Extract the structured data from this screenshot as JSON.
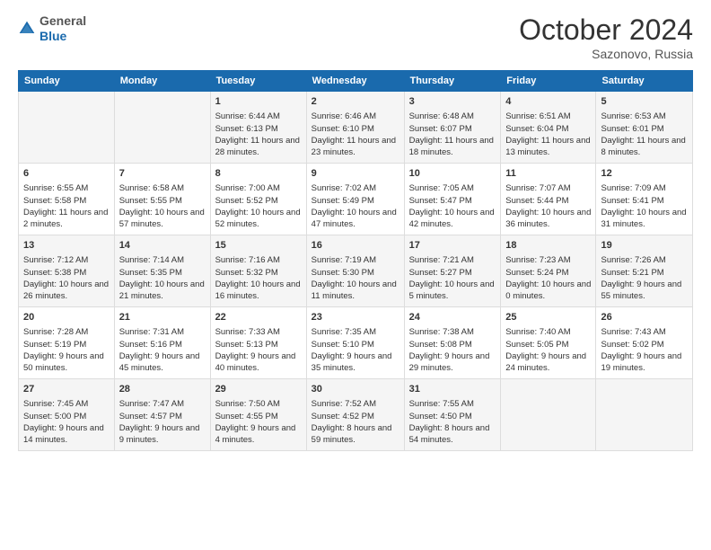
{
  "header": {
    "logo_general": "General",
    "logo_blue": "Blue",
    "month_title": "October 2024",
    "location": "Sazonovo, Russia"
  },
  "days_of_week": [
    "Sunday",
    "Monday",
    "Tuesday",
    "Wednesday",
    "Thursday",
    "Friday",
    "Saturday"
  ],
  "weeks": [
    [
      {
        "day": "",
        "content": ""
      },
      {
        "day": "",
        "content": ""
      },
      {
        "day": "1",
        "content": "Sunrise: 6:44 AM\nSunset: 6:13 PM\nDaylight: 11 hours and 28 minutes."
      },
      {
        "day": "2",
        "content": "Sunrise: 6:46 AM\nSunset: 6:10 PM\nDaylight: 11 hours and 23 minutes."
      },
      {
        "day": "3",
        "content": "Sunrise: 6:48 AM\nSunset: 6:07 PM\nDaylight: 11 hours and 18 minutes."
      },
      {
        "day": "4",
        "content": "Sunrise: 6:51 AM\nSunset: 6:04 PM\nDaylight: 11 hours and 13 minutes."
      },
      {
        "day": "5",
        "content": "Sunrise: 6:53 AM\nSunset: 6:01 PM\nDaylight: 11 hours and 8 minutes."
      }
    ],
    [
      {
        "day": "6",
        "content": "Sunrise: 6:55 AM\nSunset: 5:58 PM\nDaylight: 11 hours and 2 minutes."
      },
      {
        "day": "7",
        "content": "Sunrise: 6:58 AM\nSunset: 5:55 PM\nDaylight: 10 hours and 57 minutes."
      },
      {
        "day": "8",
        "content": "Sunrise: 7:00 AM\nSunset: 5:52 PM\nDaylight: 10 hours and 52 minutes."
      },
      {
        "day": "9",
        "content": "Sunrise: 7:02 AM\nSunset: 5:49 PM\nDaylight: 10 hours and 47 minutes."
      },
      {
        "day": "10",
        "content": "Sunrise: 7:05 AM\nSunset: 5:47 PM\nDaylight: 10 hours and 42 minutes."
      },
      {
        "day": "11",
        "content": "Sunrise: 7:07 AM\nSunset: 5:44 PM\nDaylight: 10 hours and 36 minutes."
      },
      {
        "day": "12",
        "content": "Sunrise: 7:09 AM\nSunset: 5:41 PM\nDaylight: 10 hours and 31 minutes."
      }
    ],
    [
      {
        "day": "13",
        "content": "Sunrise: 7:12 AM\nSunset: 5:38 PM\nDaylight: 10 hours and 26 minutes."
      },
      {
        "day": "14",
        "content": "Sunrise: 7:14 AM\nSunset: 5:35 PM\nDaylight: 10 hours and 21 minutes."
      },
      {
        "day": "15",
        "content": "Sunrise: 7:16 AM\nSunset: 5:32 PM\nDaylight: 10 hours and 16 minutes."
      },
      {
        "day": "16",
        "content": "Sunrise: 7:19 AM\nSunset: 5:30 PM\nDaylight: 10 hours and 11 minutes."
      },
      {
        "day": "17",
        "content": "Sunrise: 7:21 AM\nSunset: 5:27 PM\nDaylight: 10 hours and 5 minutes."
      },
      {
        "day": "18",
        "content": "Sunrise: 7:23 AM\nSunset: 5:24 PM\nDaylight: 10 hours and 0 minutes."
      },
      {
        "day": "19",
        "content": "Sunrise: 7:26 AM\nSunset: 5:21 PM\nDaylight: 9 hours and 55 minutes."
      }
    ],
    [
      {
        "day": "20",
        "content": "Sunrise: 7:28 AM\nSunset: 5:19 PM\nDaylight: 9 hours and 50 minutes."
      },
      {
        "day": "21",
        "content": "Sunrise: 7:31 AM\nSunset: 5:16 PM\nDaylight: 9 hours and 45 minutes."
      },
      {
        "day": "22",
        "content": "Sunrise: 7:33 AM\nSunset: 5:13 PM\nDaylight: 9 hours and 40 minutes."
      },
      {
        "day": "23",
        "content": "Sunrise: 7:35 AM\nSunset: 5:10 PM\nDaylight: 9 hours and 35 minutes."
      },
      {
        "day": "24",
        "content": "Sunrise: 7:38 AM\nSunset: 5:08 PM\nDaylight: 9 hours and 29 minutes."
      },
      {
        "day": "25",
        "content": "Sunrise: 7:40 AM\nSunset: 5:05 PM\nDaylight: 9 hours and 24 minutes."
      },
      {
        "day": "26",
        "content": "Sunrise: 7:43 AM\nSunset: 5:02 PM\nDaylight: 9 hours and 19 minutes."
      }
    ],
    [
      {
        "day": "27",
        "content": "Sunrise: 7:45 AM\nSunset: 5:00 PM\nDaylight: 9 hours and 14 minutes."
      },
      {
        "day": "28",
        "content": "Sunrise: 7:47 AM\nSunset: 4:57 PM\nDaylight: 9 hours and 9 minutes."
      },
      {
        "day": "29",
        "content": "Sunrise: 7:50 AM\nSunset: 4:55 PM\nDaylight: 9 hours and 4 minutes."
      },
      {
        "day": "30",
        "content": "Sunrise: 7:52 AM\nSunset: 4:52 PM\nDaylight: 8 hours and 59 minutes."
      },
      {
        "day": "31",
        "content": "Sunrise: 7:55 AM\nSunset: 4:50 PM\nDaylight: 8 hours and 54 minutes."
      },
      {
        "day": "",
        "content": ""
      },
      {
        "day": "",
        "content": ""
      }
    ]
  ]
}
